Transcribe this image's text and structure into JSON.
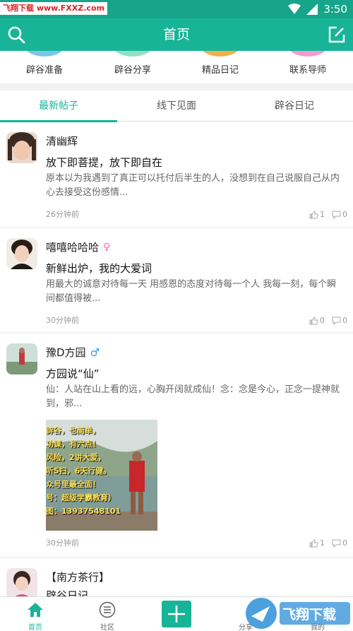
{
  "statusbar": {
    "watermark": "飞翔下载 www.FXXZ.com",
    "time": "3:50"
  },
  "header": {
    "title": "首页"
  },
  "categories": [
    {
      "label": "辟谷准备",
      "color": "#7ac6e8"
    },
    {
      "label": "辟谷分享",
      "color": "#8fe0c4"
    },
    {
      "label": "精品日记",
      "color": "#f2b04a"
    },
    {
      "label": "联系导师",
      "color": "#f39ad0"
    }
  ],
  "tabs": [
    "最新帖子",
    "线下见面",
    "辟谷日记"
  ],
  "posts": [
    {
      "user": "清幽辉",
      "gender": "",
      "title": "放下即菩提，放下即自在",
      "body": "原本以为我遇到了真正可以托付后半生的人，没想到在自己说服自己从内心去接受这份感情...",
      "time": "26分钟前",
      "likes": "1",
      "comments": "0"
    },
    {
      "user": "嘻嘻哈哈哈",
      "gender": "♀",
      "title": "新鲜出炉，我的大爱词",
      "body": "用最大的诚意对待每一天 用感恩的态度对待每一个人 我每一刻，每个瞬间都值得被...",
      "time": "30分钟前",
      "likes": "0",
      "comments": "0"
    },
    {
      "user": "豫D方园",
      "gender": "♂",
      "title": "方园说“仙”",
      "body": "仙：人站在山上看的远，心胸开阔就成仙！念：念是今心，正念一提神就到，邪...",
      "time": "30分钟前",
      "likes": "1",
      "comments": "0",
      "image_lines": [
        "辟谷，也简单，",
        "功课，有六点！",
        "风险，2讲大爱，",
        "听5扫，6天行健。",
        "众号里最全面！",
        "号：超级学霸教育）",
        "图：13937548101"
      ]
    },
    {
      "user": "【南方茶行】",
      "title": "辟谷日记"
    }
  ],
  "bottom_nav": [
    {
      "label": "首页",
      "active": true
    },
    {
      "label": "社区",
      "active": false
    },
    {
      "label": "分享",
      "active": false
    },
    {
      "label": "我的",
      "active": false
    }
  ],
  "logo_watermark": "飞翔下载"
}
